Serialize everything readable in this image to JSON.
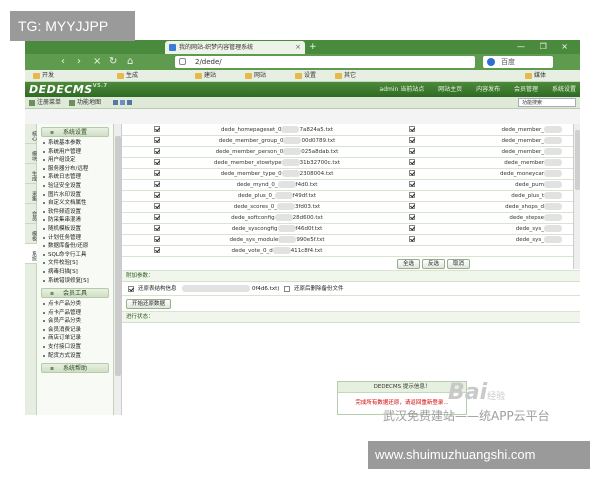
{
  "watermark_tag": "TG: MYYJJPP",
  "browser": {
    "tab_title": "我的网站-织梦内容管理系统",
    "tab_close": "×",
    "new_tab": "+",
    "window_buttons": "— ❐ ×",
    "nav_icons": [
      "‹",
      "›",
      "×",
      "↻",
      "⌂"
    ],
    "address": "2/dede/",
    "search_engine": "百度",
    "bookmarks": [
      "开发",
      "生成",
      "建站",
      "网站",
      "设置",
      "其它",
      "媒体"
    ]
  },
  "cms": {
    "logo": "DEDECMS",
    "logo_version": "V5.7",
    "top_nav": [
      "admin 当前站点",
      "网站主页",
      "内容发布",
      "会员管理",
      "系统设置"
    ],
    "sub_bar": {
      "notice": "注册菜单",
      "map": "功能地图",
      "search_placeholder": "功能搜索"
    }
  },
  "vertical_tabs": [
    "核心",
    "模块",
    "生成",
    "采集",
    "会员",
    "模板",
    "系统"
  ],
  "sidebar": {
    "groups": [
      {
        "title": "系统设置",
        "items": [
          "系统基本参数",
          "系统用户管理",
          "用户组设定",
          "服务器分布/远程",
          "系统日志管理",
          "验证安全设置",
          "图片水印设置",
          "自定义文档属性",
          "软件频道设置",
          "防采集串混淆",
          "随机模板设置",
          "计划任务管理",
          "数据库备份/还原",
          "SQL命令行工具",
          "文件校验[S]",
          "病毒扫描[S]",
          "系统错误修复[S]"
        ]
      },
      {
        "title": "会员工具",
        "items": [
          "点卡产品分类",
          "点卡产品管理",
          "会员产品分类",
          "会员消费记录",
          "商店订单记录",
          "支付接口设置",
          "配货方式设置"
        ]
      },
      {
        "title": "系统帮助",
        "items": []
      }
    ]
  },
  "file_table": {
    "rows": [
      {
        "left": "dede_homepageset_0",
        "left_tail": "7a824a5.txt",
        "right": "dede_member_"
      },
      {
        "left": "dede_member_group_0",
        "left_tail": "00d0789.txt",
        "right": "dede_member_"
      },
      {
        "left": "dede_member_person_0",
        "left_tail": "025a8dab.txt",
        "right": "dede_member_"
      },
      {
        "left": "dede_member_stowtype",
        "left_tail": "31b32700c.txt",
        "right": "dede_member"
      },
      {
        "left": "dede_member_type_0",
        "left_tail": "2308004.txt",
        "right": "dede_moneycar"
      },
      {
        "left": "dede_mynd_0_",
        "left_tail": "f4d0.txt",
        "right": "dede_pum"
      },
      {
        "left": "dede_plus_0_",
        "left_tail": "f49df.txt",
        "right": "dede_plus_t"
      },
      {
        "left": "dede_scores_0_",
        "left_tail": "3fd03.txt",
        "right": "dede_shops_d"
      },
      {
        "left": "dede_softconfig",
        "left_tail": "28d600.txt",
        "right": "dede_stepse"
      },
      {
        "left": "dede_syscongfig",
        "left_tail": "f46d0f.txt",
        "right": "dede_sys_"
      },
      {
        "left": "dede_sys_module",
        "left_tail": "990e5f.txt",
        "right": "dede_sys_"
      },
      {
        "left": "dede_vote_0_d",
        "left_tail": "411c8f4.txt",
        "right": ""
      }
    ]
  },
  "buttons": {
    "select_all": "全选",
    "invert": "反选",
    "cancel": "取消"
  },
  "extra_params_label": "附加参数：",
  "options": {
    "keep_structure": "还原表结构信息",
    "keep_structure_tail": "0f4d6.txt)",
    "delete_backup": "还原后删除备份文件"
  },
  "start_button": "开始还原数据",
  "progress_label": "进行状态：",
  "message_box": {
    "title": "DEDECMS 提示信息！",
    "body": "完成所有数据还原，请返回重新登录..."
  },
  "watermarks": {
    "baidu": "Bai",
    "baidu_jingyan": "经验",
    "site": "武汉免费建站——统APP云平台",
    "url": "www.shuimuzhuangshi.com"
  }
}
